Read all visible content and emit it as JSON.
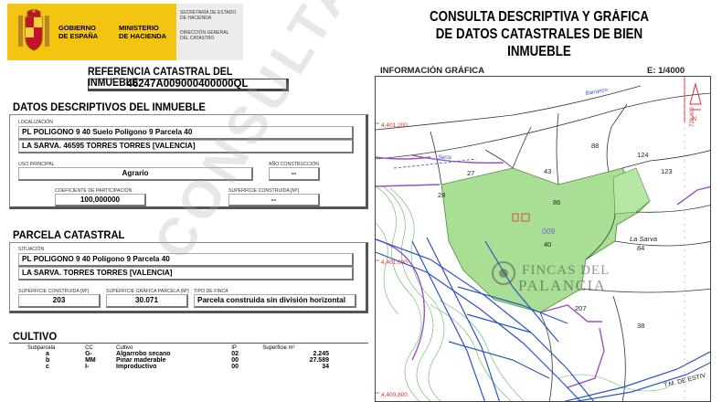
{
  "header": {
    "gov_line1": "GOBIERNO",
    "gov_line2": "DE ESPAÑA",
    "ministry_line1": "MINISTERIO",
    "ministry_line2": "DE HACIENDA",
    "sec_line1": "SECRETARÍA DE ESTADO",
    "sec_line2": "DE HACIENDA",
    "dir_line1": "DIRECCIÓN GENERAL",
    "dir_line2": "DEL CATASTRO",
    "title_line1": "CONSULTA DESCRIPTIVA Y GRÁFICA",
    "title_line2": "DE DATOS CATASTRALES DE BIEN INMUEBLE"
  },
  "referencia": {
    "title": "REFERENCIA CATASTRAL DEL INMUEBLE",
    "value": "46247A009000400000QL"
  },
  "datos": {
    "title": "DATOS DESCRIPTIVOS DEL INMUEBLE",
    "localizacion_label": "LOCALIZACIÓN",
    "localizacion_1": "PL POLIGONO  9 40 Suelo Polígono 9 Parcela 40",
    "localizacion_2": "LA SARVA. 46595 TORRES TORRES [VALENCIA]",
    "uso_label": "USO PRINCIPAL",
    "uso_value": "Agrario",
    "anio_label": "AÑO CONSTRUCCIÓN",
    "anio_value": "--",
    "coef_label": "COEFICIENTE DE PARTICIPACIÓN",
    "coef_value": "100,000000",
    "sup_label": "SUPERFICIE CONSTRUIDA [m²]",
    "sup_value": "--"
  },
  "parcela": {
    "title": "PARCELA CATASTRAL",
    "situacion_label": "SITUACIÓN",
    "situacion_1": "PL POLIGONO  9 40 Polígono 9 Parcela 40",
    "situacion_2": "LA SARVA. TORRES TORRES [VALENCIA]",
    "sup_const_label": "SUPERFICIE CONSTRUIDA [m²]",
    "sup_const_value": "203",
    "sup_graf_label": "SUPERFICIE GRÁFICA PARCELA [m²]",
    "sup_graf_value": "30.071",
    "tipo_label": "TIPO DE FINCA",
    "tipo_value": "Parcela construida sin división horizontal"
  },
  "cultivo": {
    "title": "CULTIVO",
    "headers": [
      "Subparcela",
      "CC",
      "Cultivo",
      "IP",
      "Superficie m²"
    ],
    "rows": [
      [
        "a",
        "G-",
        "Algarrobo secano",
        "02",
        "2.245"
      ],
      [
        "b",
        "MM",
        "Pinar maderable",
        "00",
        "27.589"
      ],
      [
        "c",
        "I-",
        "Improductivo",
        "00",
        "34"
      ]
    ]
  },
  "watermark": "CONSULTA",
  "map": {
    "title": "INFORMACIÓN GRÁFICA",
    "scale": "E: 1/4000",
    "coord_1": "4,401,200",
    "coord_2": "4,401,000",
    "coord_3": "4,400,800",
    "coord_4": "729,400",
    "parcel_numbers": [
      "88",
      "124",
      "27",
      "43",
      "123",
      "28",
      "86",
      "009",
      "40",
      "La Sarva",
      "84",
      "207",
      "38"
    ],
    "road_labels": [
      "Barranco",
      "Serra",
      "T.M. DE ESTIV"
    ],
    "logo_line1": "FINCAS DEL",
    "logo_line2": "PALANCIA",
    "colors": {
      "green": "#a9df95",
      "purple": "#9a4fc8",
      "blue": "#2b54c7",
      "red": "#d93030"
    }
  }
}
